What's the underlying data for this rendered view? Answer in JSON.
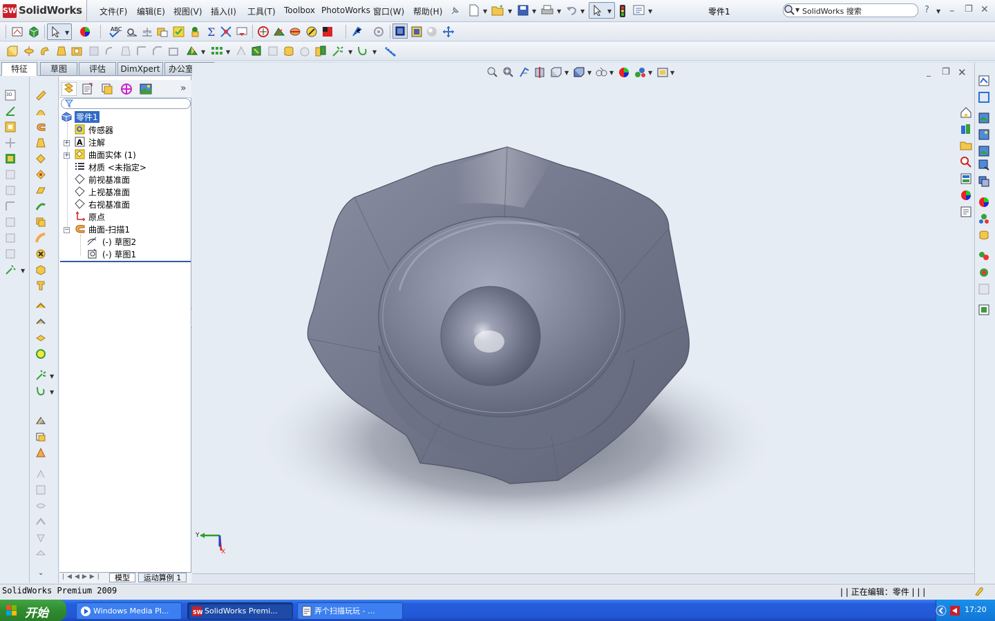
{
  "app": {
    "brand": "SolidWorks",
    "logo_mark": "SW",
    "document_title": "零件1"
  },
  "menu": [
    "文件(F)",
    "编辑(E)",
    "视图(V)",
    "插入(I)",
    "工具(T)",
    "Toolbox",
    "PhotoWorks",
    "窗口(W)",
    "帮助(H)"
  ],
  "search": {
    "placeholder": "SolidWorks 搜索"
  },
  "window_controls": {
    "help": "?",
    "minimize": "–",
    "restore": "❐",
    "close": "✕"
  },
  "command_tabs": [
    "特征",
    "草图",
    "评估",
    "DimXpert",
    "办公室产品"
  ],
  "feature_manager": {
    "collapse_label": "»",
    "root": "零件1",
    "items": [
      {
        "label": "传感器",
        "icon": "sensor-icon"
      },
      {
        "label": "注解",
        "icon": "annotation-icon",
        "expander": "+"
      },
      {
        "label": "曲面实体 (1)",
        "icon": "surface-bodies-icon",
        "expander": "+"
      },
      {
        "label": "材质 <未指定>",
        "icon": "material-icon"
      },
      {
        "label": "前视基准面",
        "icon": "plane-icon"
      },
      {
        "label": "上视基准面",
        "icon": "plane-icon"
      },
      {
        "label": "右视基准面",
        "icon": "plane-icon"
      },
      {
        "label": "原点",
        "icon": "origin-icon"
      },
      {
        "label": "曲面-扫描1",
        "icon": "sweep-surface-icon",
        "expander": "−"
      },
      {
        "label": "(-) 草图2",
        "icon": "sketch-icon"
      },
      {
        "label": "(-) 草图1",
        "icon": "sketch-icon"
      }
    ],
    "bottom_tabs": [
      "模型",
      "运动算例 1"
    ]
  },
  "triad": {
    "y_label": "Y",
    "x_label": "X"
  },
  "status": {
    "left": "SolidWorks Premium 2009",
    "right": "| | 正在编辑：零件 | | |"
  },
  "taskbar": {
    "start": "开始",
    "tasks": [
      "Windows Media Pl...",
      "SolidWorks Premi...",
      "弄个扫描玩玩 - ..."
    ],
    "clock": "17:20"
  },
  "colors": {
    "model_fill": "#6e7388",
    "model_light": "#9ea4b8",
    "background": "#e6ecf3",
    "accent": "#2357d6"
  }
}
